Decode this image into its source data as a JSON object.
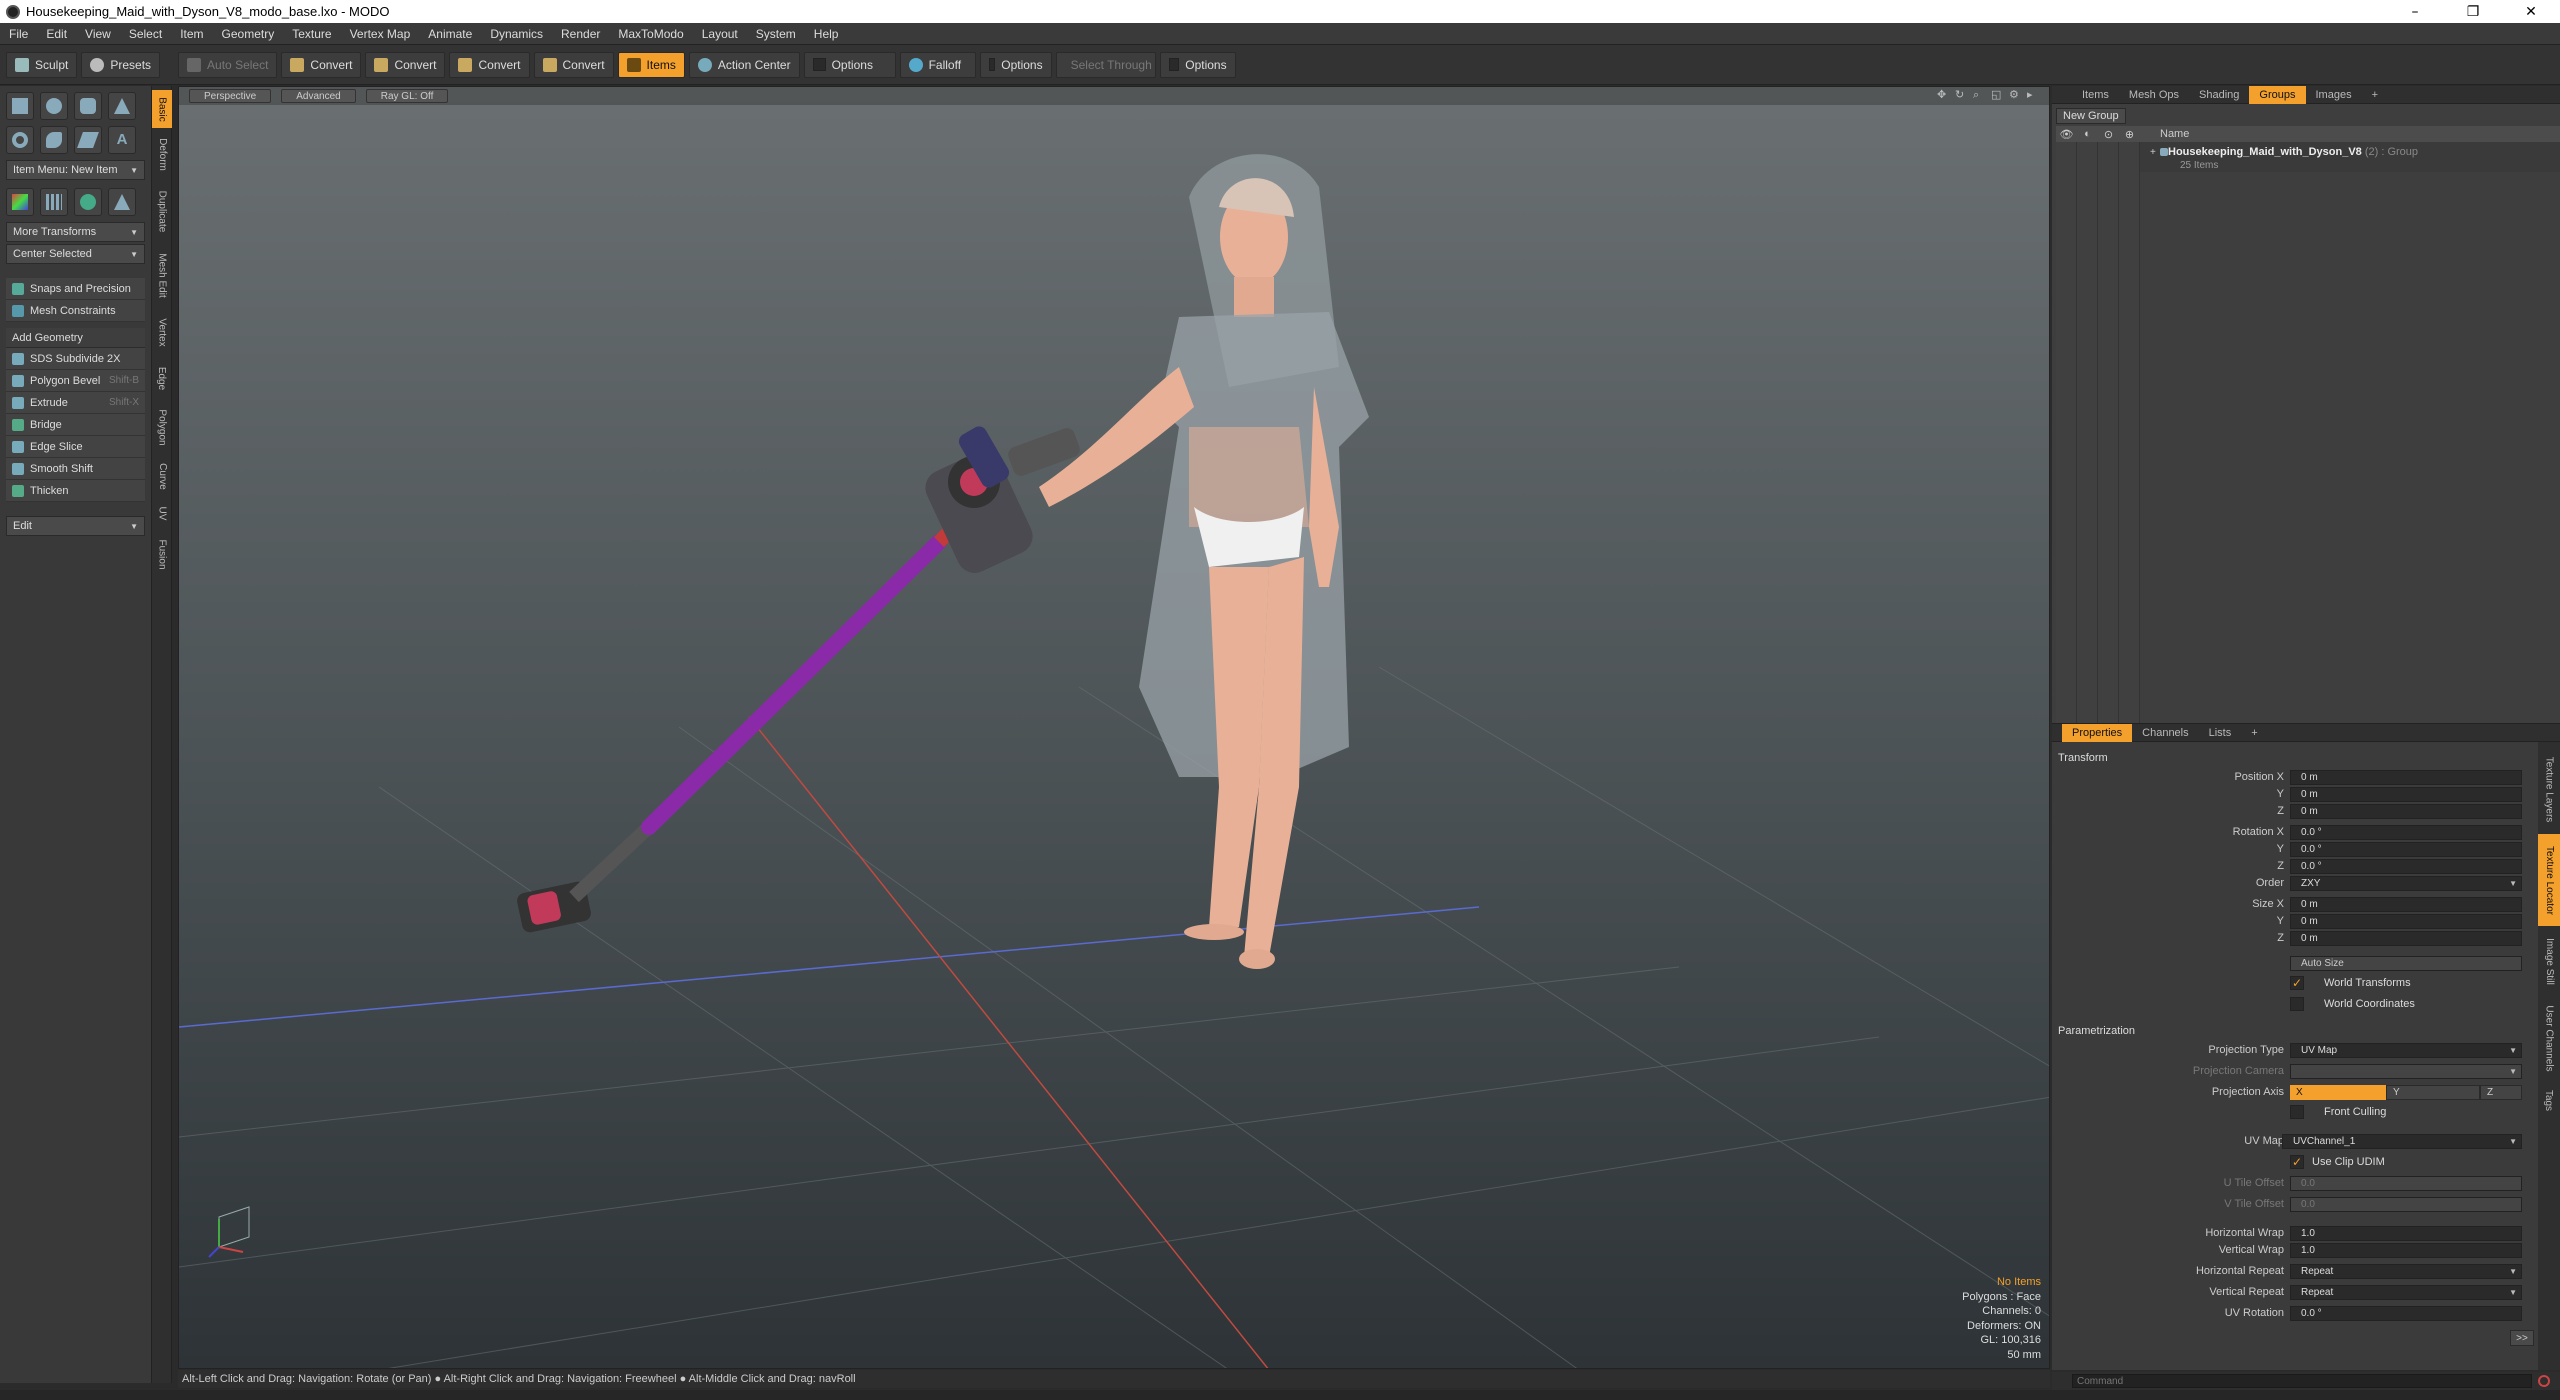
{
  "window": {
    "title": "Housekeeping_Maid_with_Dyson_V8_modo_base.lxo - MODO",
    "controls": [
      "–",
      "❐",
      "✕"
    ]
  },
  "menu": [
    "File",
    "Edit",
    "View",
    "Select",
    "Item",
    "Geometry",
    "Texture",
    "Vertex Map",
    "Animate",
    "Dynamics",
    "Render",
    "MaxToModo",
    "Layout",
    "System",
    "Help"
  ],
  "toolbar": {
    "sculpt": "Sculpt",
    "presets": "Presets",
    "auto_select": "Auto Select",
    "convert1": "Convert",
    "convert2": "Convert",
    "convert3": "Convert",
    "convert4": "Convert",
    "items": "Items",
    "action_center": "Action Center",
    "options1": "Options",
    "falloff": "Falloff",
    "options2": "Options",
    "select_through": "Select Through",
    "options3": "Options"
  },
  "left": {
    "item_menu": "Item Menu: New Item",
    "more_transforms": "More Transforms",
    "center_selected": "Center Selected",
    "snaps": "Snaps and Precision",
    "mesh_constraints": "Mesh Constraints",
    "add_geometry": "Add Geometry",
    "tools": [
      {
        "label": "SDS Subdivide 2X",
        "shortcut": ""
      },
      {
        "label": "Polygon Bevel",
        "shortcut": "Shift-B"
      },
      {
        "label": "Extrude",
        "shortcut": "Shift-X"
      },
      {
        "label": "Bridge",
        "shortcut": ""
      },
      {
        "label": "Edge Slice",
        "shortcut": ""
      },
      {
        "label": "Smooth Shift",
        "shortcut": ""
      },
      {
        "label": "Thicken",
        "shortcut": ""
      }
    ],
    "edit": "Edit",
    "vtabs": [
      "Basic",
      "Deform",
      "Duplicate",
      "Mesh Edit",
      "Vertex",
      "Edge",
      "Polygon",
      "Curve",
      "UV",
      "Fusion"
    ]
  },
  "viewport": {
    "perspective": "Perspective",
    "advanced": "Advanced",
    "raygl": "Ray GL: Off",
    "info": {
      "no_items": "No Items",
      "polygons": "Polygons : Face",
      "channels": "Channels: 0",
      "deformers": "Deformers: ON",
      "gl": "GL: 100,316",
      "mm": "50 mm"
    }
  },
  "status": "Alt-Left Click and Drag: Navigation: Rotate (or Pan) ● Alt-Right Click and Drag: Navigation: Freewheel ● Alt-Middle Click and Drag: navRoll",
  "right_top": {
    "tabs": [
      "Items",
      "Mesh Ops",
      "Shading",
      "Groups",
      "Images",
      "+"
    ],
    "new_group": "New Group",
    "name_header": "Name",
    "group_name": "Housekeeping_Maid_with_Dyson_V8",
    "group_type": "(2) : Group",
    "group_count": "25 Items"
  },
  "properties": {
    "tabs": [
      "Properties",
      "Channels",
      "Lists",
      "+"
    ],
    "transform": "Transform",
    "position_x_label": "Position X",
    "y_label": "Y",
    "z_label": "Z",
    "position": [
      "0 m",
      "0 m",
      "0 m"
    ],
    "rotation_x_label": "Rotation X",
    "rotation": [
      "0.0 °",
      "0.0 °",
      "0.0 °"
    ],
    "order_label": "Order",
    "order": "ZXY",
    "size_x_label": "Size X",
    "size": [
      "0 m",
      "0 m",
      "0 m"
    ],
    "auto_size": "Auto Size",
    "world_transforms": "World Transforms",
    "world_coordinates": "World Coordinates",
    "parametrization": "Parametrization",
    "projection_type_label": "Projection Type",
    "projection_type": "UV Map",
    "projection_camera_label": "Projection Camera",
    "projection_axis_label": "Projection Axis",
    "axis_x": "X",
    "axis_y": "Y",
    "axis_z": "Z",
    "front_culling": "Front Culling",
    "uv_map_label": "UV Map",
    "uv_map": "UVChannel_1",
    "use_clip_udim": "Use Clip UDIM",
    "u_tile_offset_label": "U Tile Offset",
    "u_tile_offset": "0.0",
    "v_tile_offset_label": "V Tile Offset",
    "v_tile_offset": "0.0",
    "horizontal_wrap_label": "Horizontal Wrap",
    "horizontal_wrap": "1.0",
    "vertical_wrap_label": "Vertical Wrap",
    "vertical_wrap": "1.0",
    "horizontal_repeat_label": "Horizontal Repeat",
    "horizontal_repeat": "Repeat",
    "vertical_repeat_label": "Vertical Repeat",
    "vertical_repeat": "Repeat",
    "uv_rotation_label": "UV Rotation",
    "uv_rotation": "0.0 °",
    "more": ">>",
    "vtabs": [
      "Texture Layers",
      "Texture Locator",
      "Image Still",
      "User Channels",
      "Tags"
    ]
  },
  "command": {
    "placeholder": "Command"
  },
  "colors": {
    "accent": "#f3a02c",
    "vacuum_wand": "#8a2aa8",
    "skin": "#e8b197",
    "dress": "#9aa3a8"
  }
}
